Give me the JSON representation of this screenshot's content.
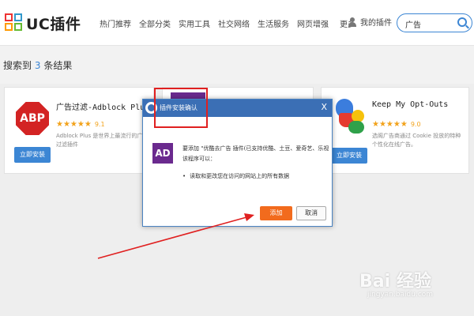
{
  "header": {
    "logo_text": "UC插件",
    "nav": [
      "热门推荐",
      "全部分类",
      "实用工具",
      "社交网络",
      "生活服务",
      "网页增强",
      "更多"
    ],
    "user_label": "我的插件",
    "search_value": "广告"
  },
  "results": {
    "prefix": "搜索到",
    "count": "3",
    "suffix": "条结果"
  },
  "cards": [
    {
      "icon_text": "ABP",
      "title": "广告过滤-Adblock Plus",
      "stars": "★★★★★",
      "rating": "9.1",
      "desc": "Adblock Plus 是世界上最流行的广告过滤插件",
      "install": "立即安装"
    },
    {
      "title": "",
      "stars": "",
      "rating": "",
      "desc": "",
      "install": ""
    },
    {
      "title": "Keep My Opt-Outs",
      "stars": "★★★★★",
      "rating": "9.0",
      "desc": "选阁广告商通过 Cookie 投放的特种个性化在线广告。",
      "install": "立即安装"
    }
  ],
  "dialog": {
    "title": "插件安装确认",
    "close": "X",
    "icon_text": "AD",
    "message": "要添加 \"优酷去广告 插件(已支持优酷、土豆、爱奇艺、乐视该程序可以：",
    "permission": "读取和更改您在访问的网站上的所有数据",
    "add_label": "添加",
    "cancel_label": "取消"
  },
  "watermark": {
    "text": "Bai 经验",
    "sub": "jingyan.baidu.com"
  },
  "colors": {
    "accent": "#3c86d4",
    "dialog_header": "#3b6fb5",
    "add_button": "#f26b1d",
    "annotation": "#e02020"
  }
}
